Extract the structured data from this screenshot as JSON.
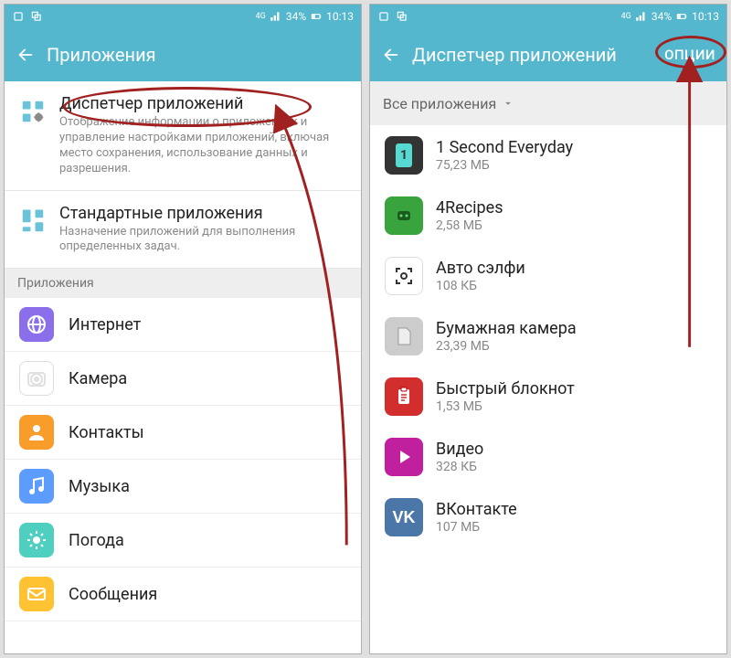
{
  "status": {
    "network": "4G",
    "battery": "34%",
    "time": "10:13"
  },
  "left": {
    "header_title": "Приложения",
    "settings": [
      {
        "title": "Диспетчер приложений",
        "subtitle": "Отображение информации о приложениях и управление настройками приложений, включая место сохранения, использование данных и разрешения."
      },
      {
        "title": "Стандартные приложения",
        "subtitle": "Назначение приложений для выполнения определенных задач."
      }
    ],
    "section_header": "Приложения",
    "apps": [
      {
        "label": "Интернет",
        "icon_bg": "#8a6eea",
        "icon_fg": "#fff",
        "glyph": "globe"
      },
      {
        "label": "Камера",
        "icon_bg": "#ffffff",
        "icon_fg": "#e0e0e0",
        "glyph": "camera"
      },
      {
        "label": "Контакты",
        "icon_bg": "#f89c2a",
        "icon_fg": "#fff",
        "glyph": "person"
      },
      {
        "label": "Музыка",
        "icon_bg": "#5d9cff",
        "icon_fg": "#fff",
        "glyph": "note"
      },
      {
        "label": "Погода",
        "icon_bg": "#4ecfbf",
        "icon_fg": "#fff",
        "glyph": "sun"
      },
      {
        "label": "Сообщения",
        "icon_bg": "#ffc233",
        "icon_fg": "#fff",
        "glyph": "mail"
      }
    ]
  },
  "right": {
    "header_title": "Диспетчер приложений",
    "header_options": "ОПЦИИ",
    "tab_label": "Все приложения",
    "apps": [
      {
        "name": "1 Second Everyday",
        "size": "75,23 МБ",
        "icon_bg": "#333333",
        "icon_fg": "#55d9d0",
        "glyph": "1"
      },
      {
        "name": "4Recipes",
        "size": "2,58 МБ",
        "icon_bg": "#39a43e",
        "icon_fg": "#1a5c1e",
        "glyph": "bot"
      },
      {
        "name": "Авто сэлфи",
        "size": "108 КБ",
        "icon_bg": "#ffffff",
        "icon_fg": "#333",
        "glyph": "focus"
      },
      {
        "name": "Бумажная камера",
        "size": "23,39 МБ",
        "icon_bg": "#cccccc",
        "icon_fg": "#eee",
        "glyph": "paper"
      },
      {
        "name": "Быстрый блокнот",
        "size": "1,53 МБ",
        "icon_bg": "#d32e2e",
        "icon_fg": "#fff",
        "glyph": "clipboard"
      },
      {
        "name": "Видео",
        "size": "328 КБ",
        "icon_bg": "#c01f9e",
        "icon_fg": "#fff",
        "glyph": "play"
      },
      {
        "name": "ВКонтакте",
        "size": "107 МБ",
        "icon_bg": "#4a76a8",
        "icon_fg": "#fff",
        "glyph": "VK"
      }
    ]
  }
}
